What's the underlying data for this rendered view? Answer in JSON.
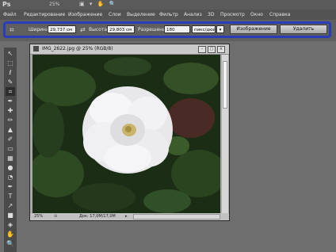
{
  "app": {
    "logo": "Ps",
    "zoom": "25%",
    "icons": "▣ ▾ ✋ 🔍"
  },
  "menu": [
    "Файл",
    "Редактирование",
    "Изображение",
    "Слои",
    "Выделение",
    "Фильтр",
    "Анализ",
    "3D",
    "Просмотр",
    "Окно",
    "Справка"
  ],
  "options": {
    "width_label": "Ширина:",
    "width_value": "29,737 см",
    "height_label": "Высота:",
    "height_value": "29,803 см",
    "resolution_label": "Разрешение:",
    "resolution_value": "180",
    "resolution_unit": "пикс/дюйм",
    "image_button": "Изображение",
    "delete_button": "Удалить"
  },
  "document": {
    "title": "IMG_2622.jpg @ 25% (RGB/8)",
    "zoom": "25%",
    "doc_size": "Док: 17,0М/17,0М"
  },
  "colors": {
    "highlight": "#2a3db8",
    "background": "#6e6e6e"
  }
}
